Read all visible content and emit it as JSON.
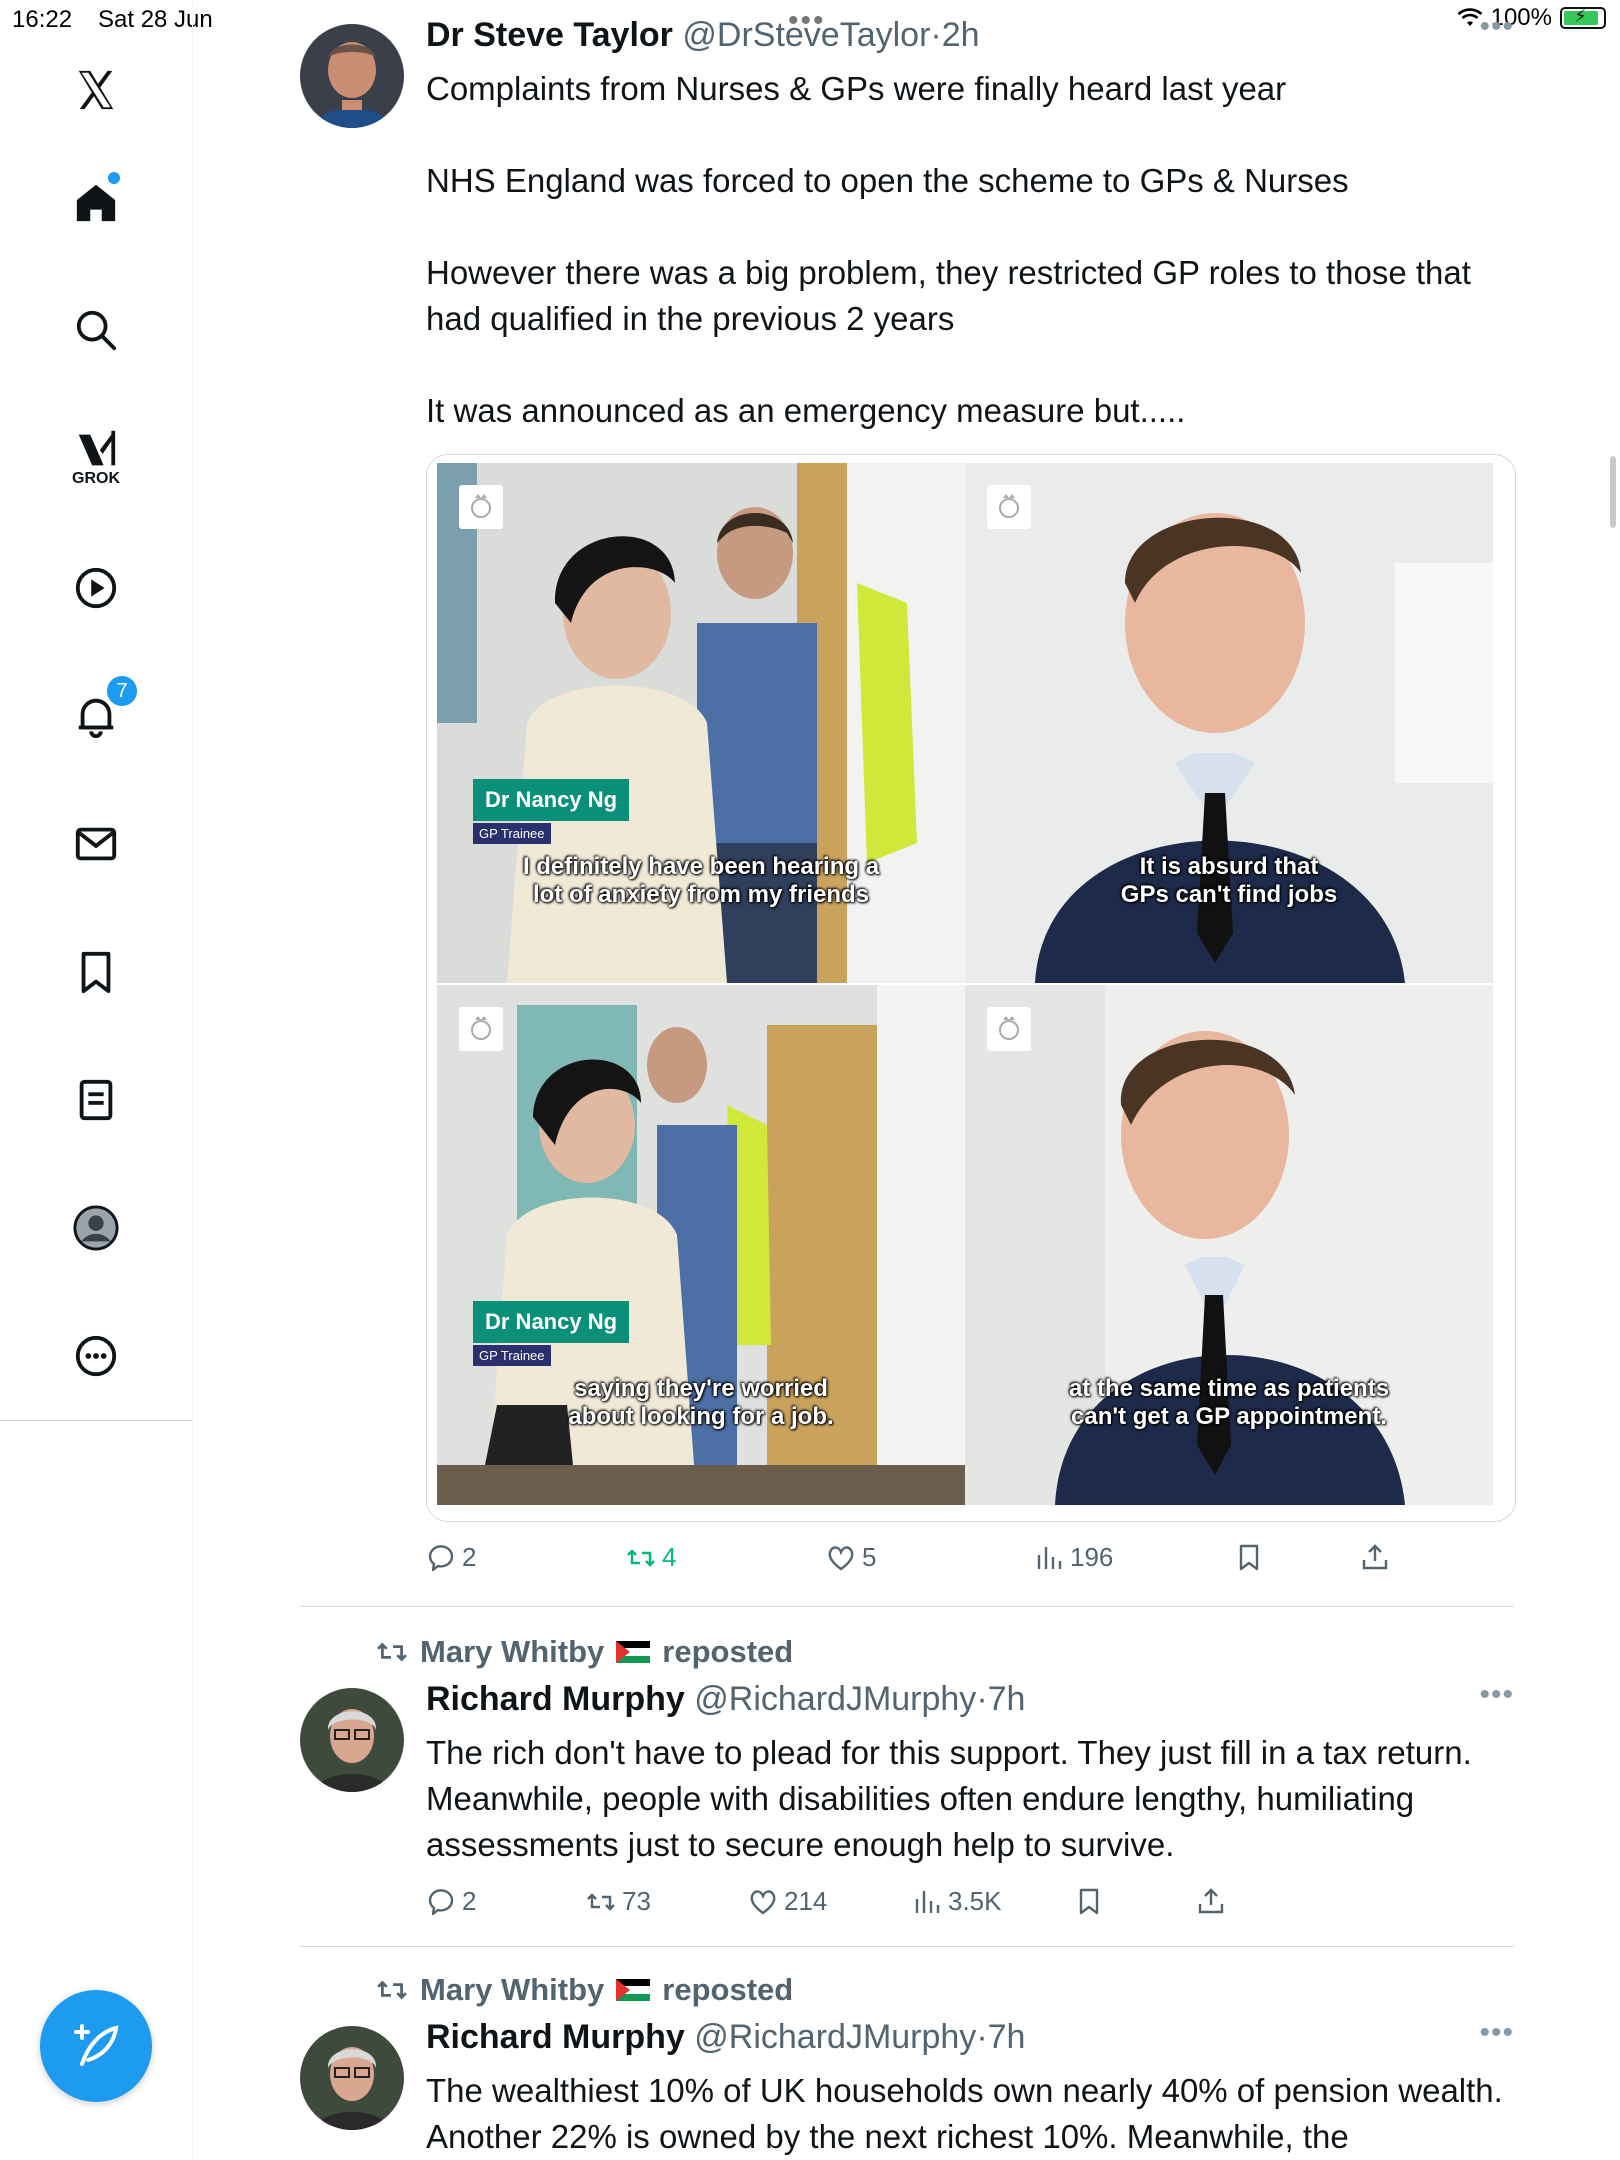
{
  "status_bar": {
    "time": "16:22",
    "date": "Sat 28 Jun",
    "battery": "100%"
  },
  "sidebar": {
    "grok_label": "GROK",
    "notification_count": "7"
  },
  "tweets": [
    {
      "author": "Dr Steve Taylor",
      "handle": "@DrSteveTaylor",
      "time": "2h",
      "text": "Complaints from Nurses & GPs were finally heard last year\n\nNHS England was forced to open the scheme to GPs & Nurses\n\nHowever there was a big problem, they restricted GP roles to those that had qualified in the previous 2 years\n\nIt was announced as an emergency measure but.....",
      "media": {
        "tiles": [
          {
            "name_tag": "Dr Nancy Ng",
            "role_tag": "GP Trainee",
            "caption": "I definitely have been hearing a\nlot of anxiety from my friends"
          },
          {
            "caption": "It is absurd that\nGPs can't  find jobs"
          },
          {
            "name_tag": "Dr Nancy Ng",
            "role_tag": "GP Trainee",
            "caption": "saying they're worried\nabout looking for a job."
          },
          {
            "caption": "at the same time as patients\ncan't get a GP appointment."
          }
        ]
      },
      "replies": "2",
      "reposts": "4",
      "likes": "5",
      "views": "196"
    },
    {
      "reposted_by": "Mary Whitby",
      "reposted_label": "reposted",
      "author": "Richard Murphy",
      "handle": "@RichardJMurphy",
      "time": "7h",
      "text": "The rich don't have to plead for this support. They just fill in a tax return. Meanwhile, people with disabilities often endure lengthy, humiliating assessments just to secure enough help to survive.",
      "replies": "2",
      "reposts": "73",
      "likes": "214",
      "views": "3.5K"
    },
    {
      "reposted_by": "Mary Whitby",
      "reposted_label": "reposted",
      "author": "Richard Murphy",
      "handle": "@RichardJMurphy",
      "time": "7h",
      "text": "The wealthiest 10% of UK households own nearly 40% of pension wealth. Another 22% is owned by the next richest 10%. Meanwhile, the"
    }
  ],
  "colors": {
    "accent": "#1d9bf0",
    "repost_green": "#00ba7c",
    "text_secondary": "#536471"
  }
}
